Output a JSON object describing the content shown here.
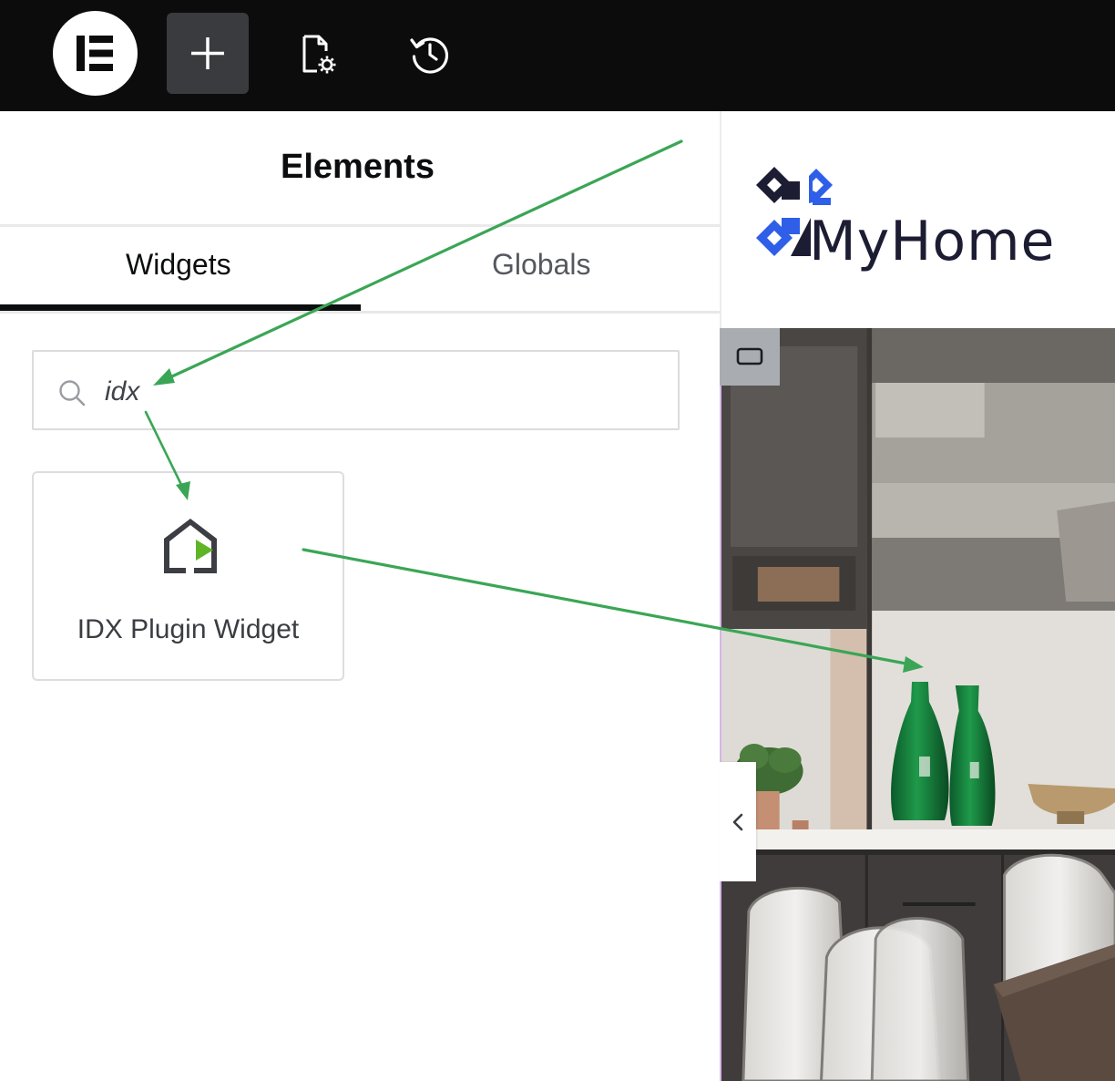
{
  "toolbar": {
    "icons": [
      "elementor-logo-icon",
      "plus-icon",
      "page-settings-icon",
      "history-icon"
    ]
  },
  "panel": {
    "title": "Elements",
    "tabs": [
      {
        "label": "Widgets",
        "active": true
      },
      {
        "label": "Globals",
        "active": false
      }
    ],
    "search": {
      "value": "idx",
      "icon": "search-icon"
    },
    "results": [
      {
        "label": "IDX Plugin Widget",
        "icon": "idx-house-play-icon"
      }
    ]
  },
  "preview": {
    "brand_name": "MyHome",
    "brand_colors": {
      "dark": "#1c1d33",
      "blue": "#2f5fe8"
    }
  },
  "colors": {
    "toolbar_bg": "#0c0c0d",
    "accent_play": "#5fb526",
    "annotation_arrow": "#3aa655"
  }
}
